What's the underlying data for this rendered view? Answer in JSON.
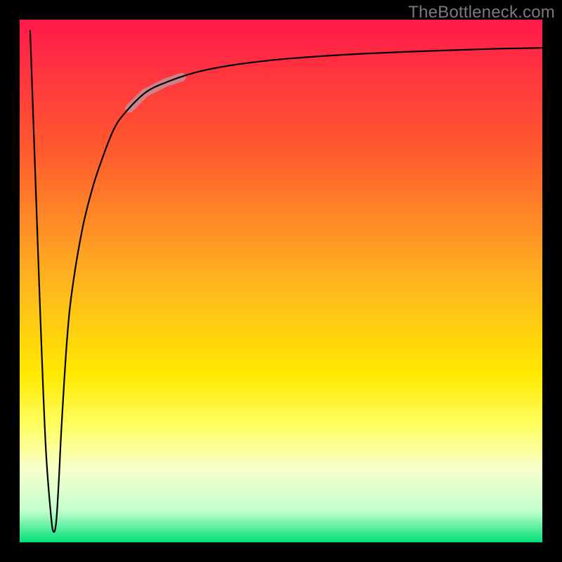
{
  "attribution": "TheBottleneck.com",
  "chart_data": {
    "type": "line",
    "title": "",
    "xlabel": "",
    "ylabel": "",
    "xlim": [
      0,
      100
    ],
    "ylim": [
      0,
      100
    ],
    "gradient_stops": [
      {
        "offset": 0,
        "color": "#ff1a4b"
      },
      {
        "offset": 25,
        "color": "#ff5a2e"
      },
      {
        "offset": 50,
        "color": "#ffb41f"
      },
      {
        "offset": 68,
        "color": "#ffea00"
      },
      {
        "offset": 78,
        "color": "#ffff66"
      },
      {
        "offset": 86,
        "color": "#f7ffcc"
      },
      {
        "offset": 94,
        "color": "#c3ffcc"
      },
      {
        "offset": 100,
        "color": "#00e07a"
      }
    ],
    "series": [
      {
        "name": "bottleneck-curve",
        "x": [
          2,
          3,
          4,
          5,
          6,
          6.5,
          7,
          7.5,
          8,
          9,
          10,
          12,
          14,
          16,
          18,
          20,
          24,
          28,
          34,
          42,
          52,
          64,
          78,
          90,
          100
        ],
        "y": [
          98,
          70,
          42,
          18,
          5,
          2,
          4,
          12,
          22,
          38,
          48,
          60,
          68,
          74,
          79,
          82,
          86,
          88,
          90,
          91.5,
          92.6,
          93.4,
          94,
          94.4,
          94.6
        ]
      }
    ],
    "highlight_segment": {
      "x_start": 21,
      "x_end": 31
    }
  }
}
